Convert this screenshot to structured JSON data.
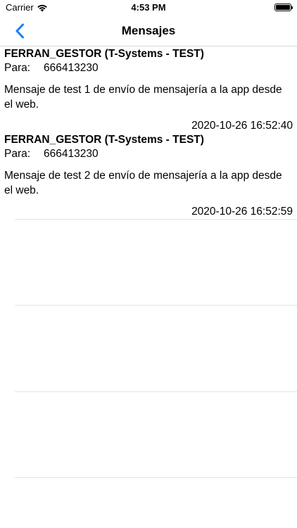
{
  "status_bar": {
    "carrier": "Carrier",
    "time": "4:53 PM"
  },
  "nav": {
    "title": "Mensajes",
    "accent_color": "#1a7ef5"
  },
  "messages": [
    {
      "sender": "FERRAN_GESTOR (T-Systems - TEST)",
      "to_label": "Para:",
      "to_value": "666413230",
      "body": "Mensaje de test 1 de envío de mensajería a la app desde el web.",
      "date": "2020-10-26 16:52:40"
    },
    {
      "sender": "FERRAN_GESTOR (T-Systems - TEST)",
      "to_label": "Para:",
      "to_value": "666413230",
      "body": "Mensaje de test 2 de envío de mensajería a la app desde el web.",
      "date": "2020-10-26 16:52:59"
    }
  ]
}
